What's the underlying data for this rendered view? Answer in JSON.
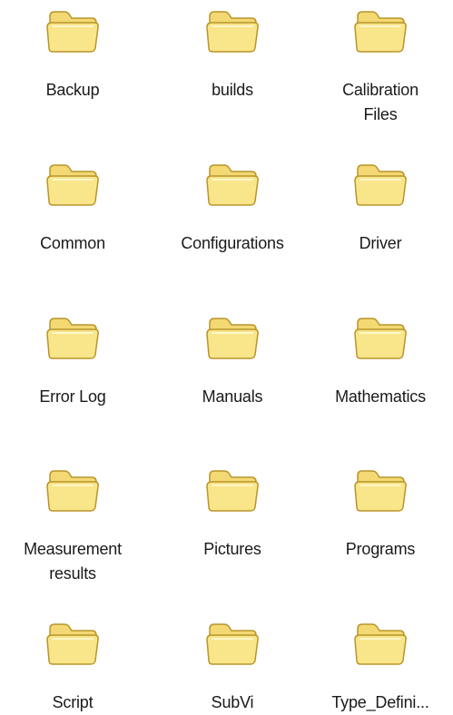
{
  "folders": [
    {
      "label": "Backup",
      "icon": "folder-icon"
    },
    {
      "label": "builds",
      "icon": "folder-icon"
    },
    {
      "label": "Calibration Files",
      "icon": "folder-icon"
    },
    {
      "label": "Common",
      "icon": "folder-icon"
    },
    {
      "label": "Configurations",
      "icon": "folder-icon"
    },
    {
      "label": "Driver",
      "icon": "folder-icon"
    },
    {
      "label": "Error Log",
      "icon": "folder-icon"
    },
    {
      "label": "Manuals",
      "icon": "folder-icon"
    },
    {
      "label": "Mathematics",
      "icon": "folder-icon"
    },
    {
      "label": "Measurement results",
      "icon": "folder-icon"
    },
    {
      "label": "Pictures",
      "icon": "folder-icon"
    },
    {
      "label": "Programs",
      "icon": "folder-icon"
    },
    {
      "label": "Script",
      "icon": "folder-icon"
    },
    {
      "label": "SubVi",
      "icon": "folder-icon"
    },
    {
      "label": "Type_Defini...",
      "icon": "folder-icon"
    }
  ],
  "colors": {
    "folder_fill": "#f7e27f",
    "folder_light": "#fdf2b2",
    "folder_outline": "#b8952a",
    "background": "#ffffff"
  }
}
